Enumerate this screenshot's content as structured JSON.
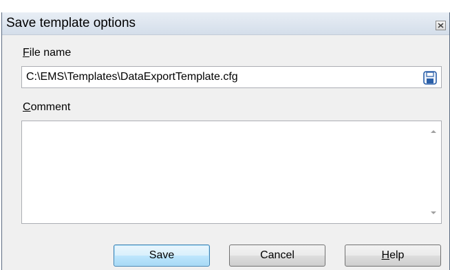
{
  "dialog": {
    "title": "Save template options",
    "close_icon": "close-icon"
  },
  "file_name": {
    "label_accel": "F",
    "label_rest": "ile name",
    "value": "C:\\EMS\\Templates\\DataExportTemplate.cfg",
    "browse_icon": "floppy-disk-icon"
  },
  "comment": {
    "label_accel": "C",
    "label_rest": "omment",
    "value": ""
  },
  "buttons": {
    "save": "Save",
    "cancel": "Cancel",
    "help_accel": "H",
    "help_rest": "elp"
  },
  "colors": {
    "title_bar": "#dde5ef",
    "dialog_bg": "#f0f0f0",
    "default_button_border": "#3c7fb1",
    "save_icon_blue": "#2a5fa8"
  }
}
